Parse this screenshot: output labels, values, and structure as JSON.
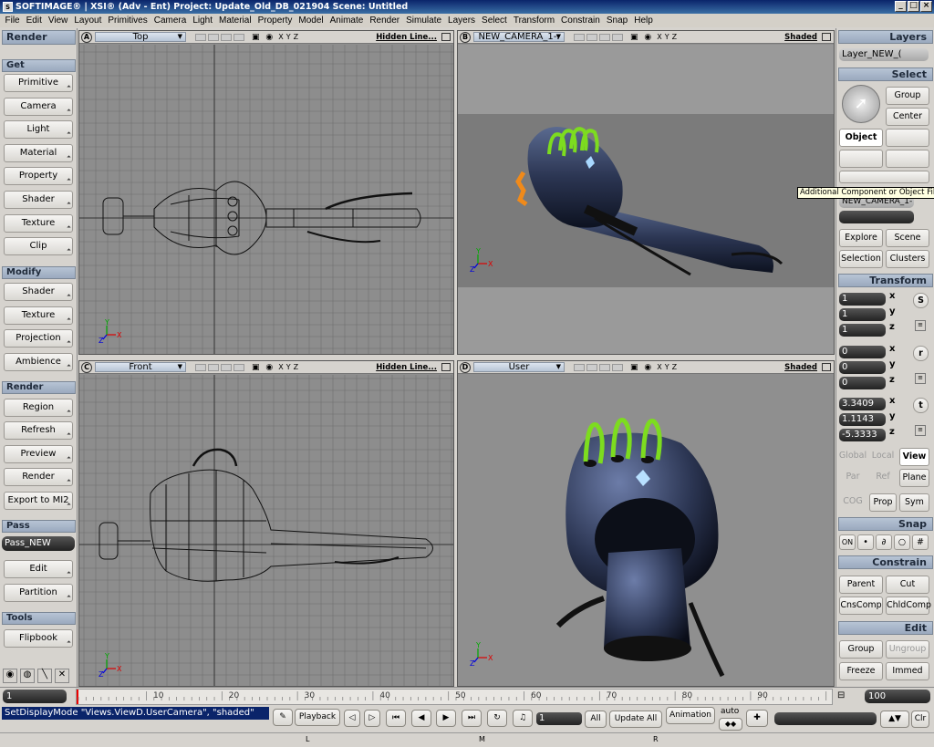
{
  "window": {
    "title": "SOFTIMAGE® | XSI® (Adv - Ent) Project: Update_Old_DB_021904    Scene: Untitled",
    "logo_text": "S"
  },
  "menu": [
    "File",
    "Edit",
    "View",
    "Layout",
    "Primitives",
    "Camera",
    "Light",
    "Material",
    "Property",
    "Model",
    "Animate",
    "Render",
    "Simulate",
    "Layers",
    "Select",
    "Transform",
    "Constrain",
    "Snap",
    "Help"
  ],
  "left_panel": {
    "title": "Render",
    "sections": [
      {
        "header": "Get",
        "items": [
          "Primitive",
          "Camera",
          "Light",
          "Material",
          "Property",
          "Shader",
          "Texture",
          "Clip"
        ]
      },
      {
        "header": "Modify",
        "items": [
          "Shader",
          "Texture",
          "Projection",
          "Ambience"
        ]
      },
      {
        "header": "Render",
        "items": [
          "Region",
          "Refresh",
          "Preview",
          "Render",
          "Export to MI2"
        ]
      },
      {
        "header": "Pass",
        "pass_value": "Pass_NEW",
        "items": [
          "Edit",
          "Partition"
        ]
      },
      {
        "header": "Tools",
        "items": [
          "Flipbook"
        ]
      }
    ]
  },
  "viewports": [
    {
      "letter": "A",
      "name": "Top",
      "mode": "Hidden Line..."
    },
    {
      "letter": "B",
      "name": "NEW_CAMERA_1-.",
      "mode": "Shaded"
    },
    {
      "letter": "C",
      "name": "Front",
      "mode": "Hidden Line..."
    },
    {
      "letter": "D",
      "name": "User",
      "mode": "Shaded"
    }
  ],
  "axis_labels": {
    "x": "X",
    "y": "Y",
    "z": "Z"
  },
  "right_panel": {
    "layers_header": "Layers",
    "layer_value": "Layer_NEW_(",
    "select_header": "Select",
    "group_btn": "Group",
    "center_btn": "Center",
    "object_btn": "Object",
    "camera_field": "NEW_CAMERA_1-",
    "explore_btn": "Explore",
    "scene_btn": "Scene",
    "selection_btn": "Selection",
    "clusters_btn": "Clusters",
    "transform_header": "Transform",
    "scale": [
      "1",
      "1",
      "1"
    ],
    "rotate": [
      "0",
      "0",
      "0"
    ],
    "translate": [
      "3.3409",
      "1.1143",
      "-5.3333"
    ],
    "axes": [
      "x",
      "y",
      "z"
    ],
    "srt": [
      "S",
      "r",
      "t"
    ],
    "global_btn": "Global",
    "local_btn": "Local",
    "view_btn": "View",
    "par_btn": "Par",
    "ref_btn": "Ref",
    "plane_btn": "Plane",
    "cog_btn": "COG",
    "prop_btn": "Prop",
    "sym_btn": "Sym",
    "snap_header": "Snap",
    "snap_on": "ON",
    "constrain_header": "Constrain",
    "parent_btn": "Parent",
    "cut_btn": "Cut",
    "cnscomp_btn": "CnsComp",
    "chldcomp_btn": "ChldComp",
    "edit_header": "Edit",
    "group2_btn": "Group",
    "ungroup_btn": "Ungroup",
    "freeze_btn": "Freeze",
    "immed_btn": "Immed"
  },
  "tooltip": "Additional Component or Object Filter",
  "timeline": {
    "start": "1",
    "end": "100",
    "ticks": [
      "10",
      "20",
      "30",
      "40",
      "50",
      "60",
      "70",
      "80",
      "90"
    ]
  },
  "command": {
    "script": "SetDisplayMode \"Views.ViewD.UserCamera\", \"shaded\"",
    "playback_btn": "Playback",
    "frame": "1",
    "all_btn": "All",
    "update_btn": "Update All",
    "animation_btn": "Animation",
    "auto_label": "auto",
    "clr_btn": "Clr"
  },
  "bottom_marks": [
    "L",
    "M",
    "R"
  ],
  "colors": {
    "accent_green": "#7ddc1f",
    "body_blue": "#2b3552",
    "titlebar": "#0a246a"
  }
}
